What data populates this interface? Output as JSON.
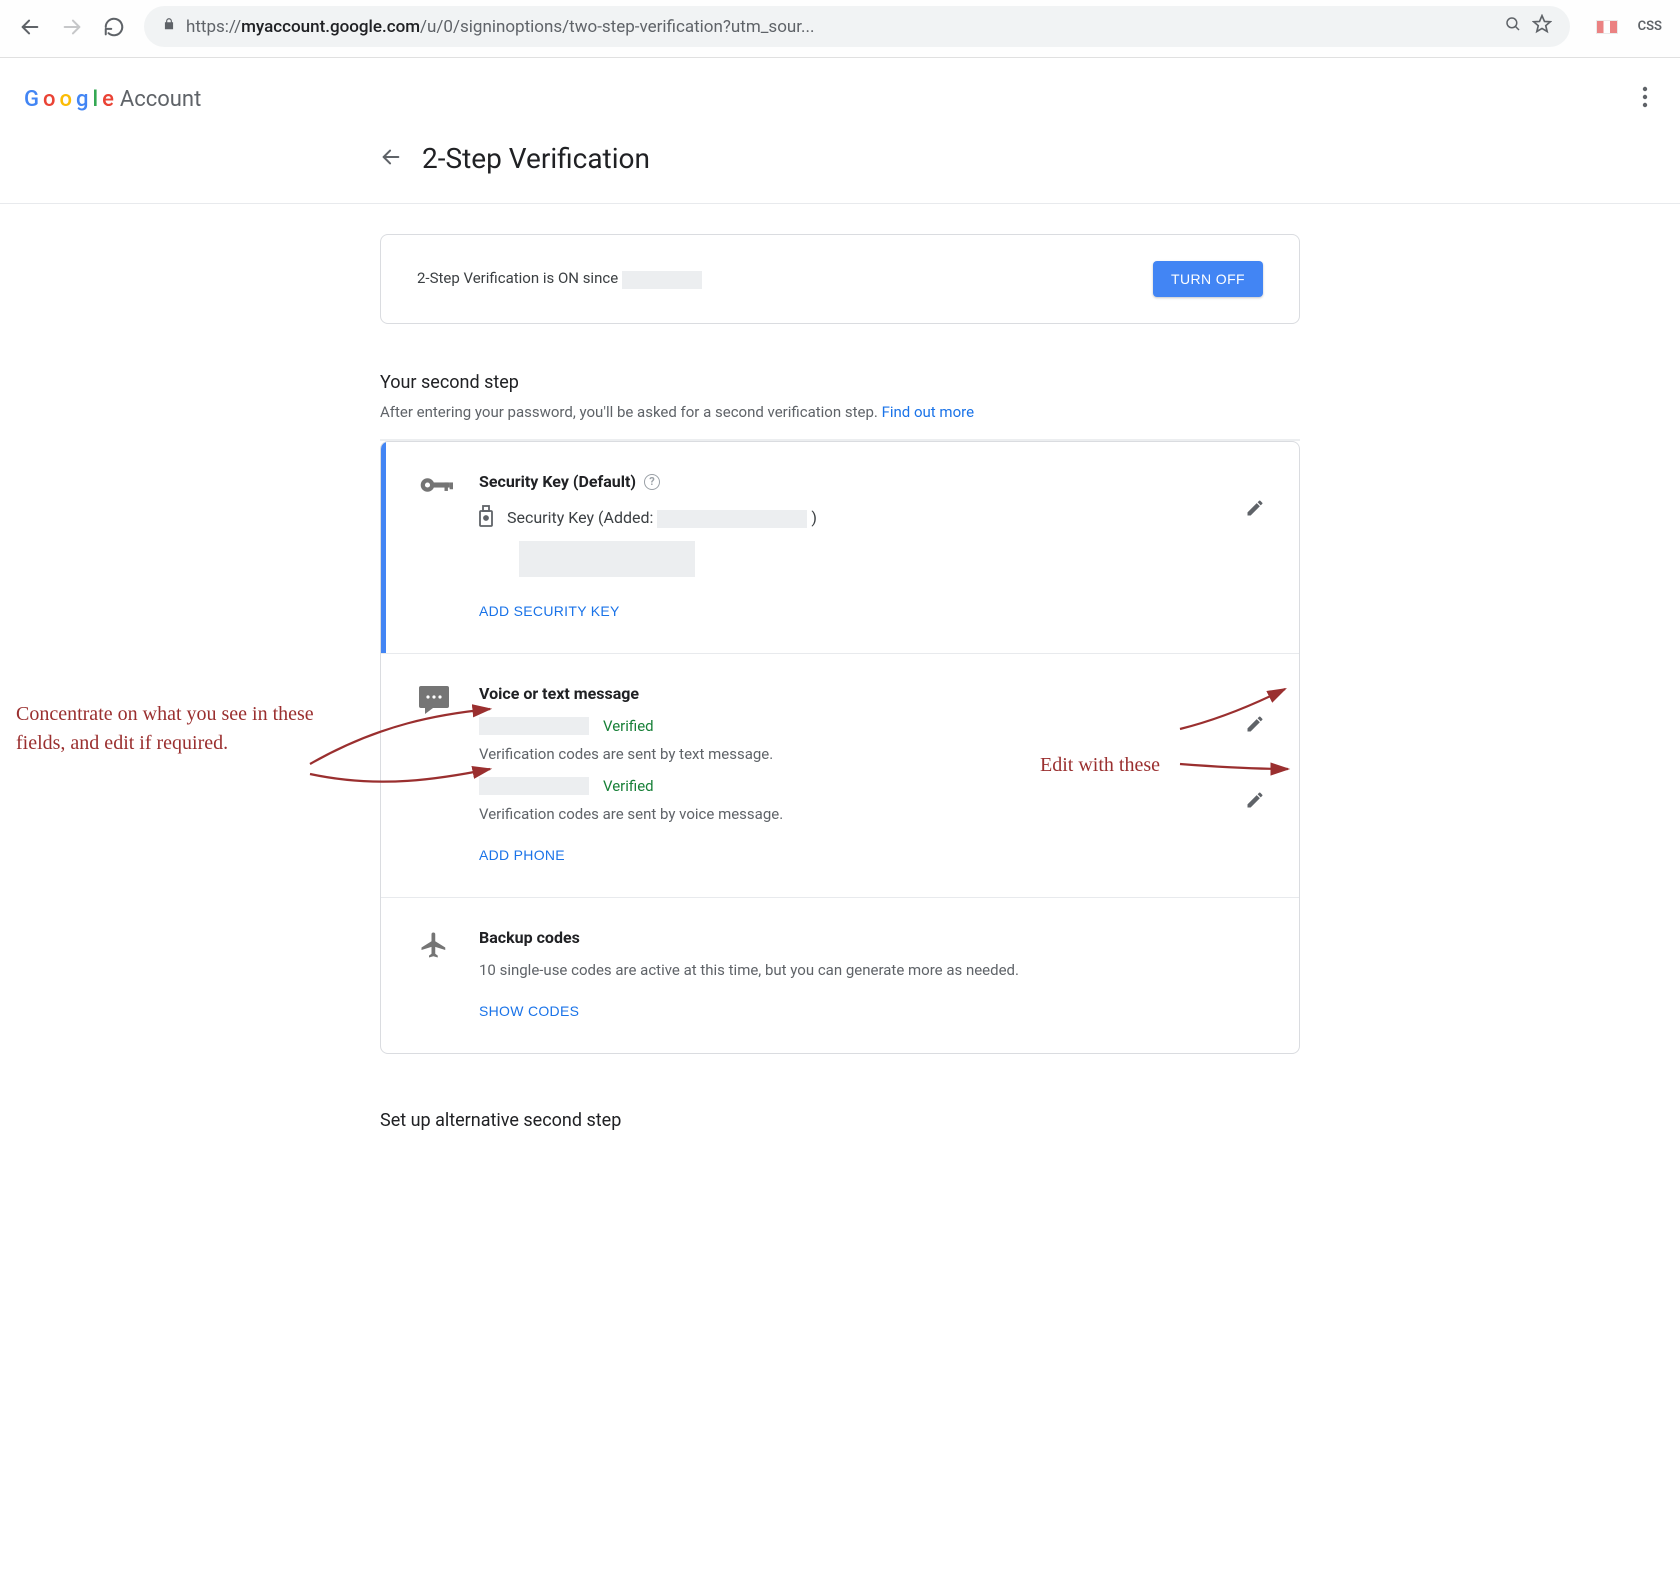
{
  "browser": {
    "url_proto": "https://",
    "url_host": "myaccount.google.com",
    "url_path": "/u/0/signinoptions/two-step-verification?utm_sour...",
    "css_ext": "CSS"
  },
  "brand": {
    "g1": "G",
    "g2": "o",
    "g3": "o",
    "g4": "g",
    "g5": "l",
    "g6": "e",
    "account": "Account"
  },
  "page": {
    "title": "2-Step Verification",
    "status_prefix": "2-Step Verification is ON since",
    "turn_off": "TURN OFF",
    "second_step_heading": "Your second step",
    "second_step_desc": "After entering your password, you'll be asked for a second verification step.",
    "find_out_more": "Find out more",
    "alt_heading": "Set up alternative second step"
  },
  "steps": {
    "security_key": {
      "title": "Security Key (Default)",
      "sub_label_pre": "Security Key (Added:",
      "sub_label_post": ")",
      "add_btn": "ADD SECURITY KEY"
    },
    "voice_text": {
      "title": "Voice or text message",
      "verified": "Verified",
      "desc_text": "Verification codes are sent by text message.",
      "desc_voice": "Verification codes are sent by voice message.",
      "add_btn": "ADD PHONE"
    },
    "backup": {
      "title": "Backup codes",
      "desc": "10 single-use codes are active at this time, but you can generate more as needed.",
      "show_btn": "SHOW CODES"
    }
  },
  "annotations": {
    "left": "Concentrate on what you see in these fields, and edit if required.",
    "right": "Edit with these"
  }
}
